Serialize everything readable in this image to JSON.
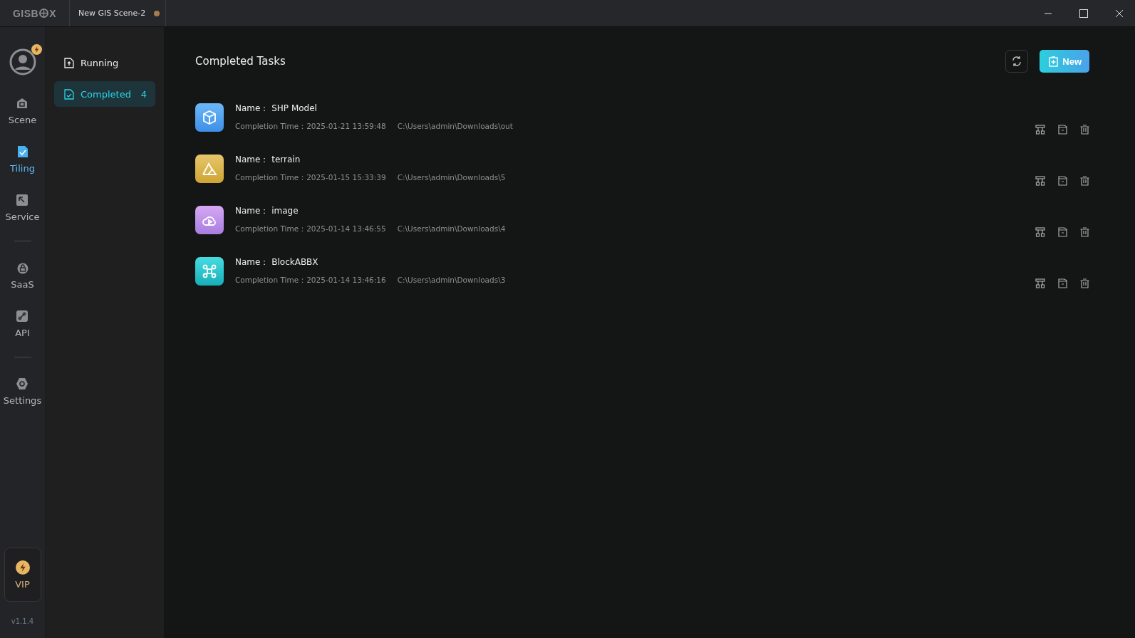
{
  "logo": {
    "before": "GISB",
    "after": "X"
  },
  "tabs": [
    {
      "label": "New GIS Scene-2",
      "selected": true,
      "unsaved": true
    }
  ],
  "rail": [
    {
      "kind": "avatar",
      "badge": true
    },
    {
      "kind": "item",
      "label": "Scene",
      "selected": false
    },
    {
      "kind": "item",
      "label": "Tiling",
      "selected": true
    },
    {
      "kind": "item",
      "label": "Service",
      "selected": false
    },
    {
      "kind": "divider"
    },
    {
      "kind": "item",
      "label": "SaaS",
      "selected": false
    },
    {
      "kind": "item",
      "label": "API",
      "selected": false
    },
    {
      "kind": "divider"
    },
    {
      "kind": "item",
      "label": "Settings",
      "selected": false
    }
  ],
  "vip": {
    "label": "VIP"
  },
  "version": "v1.1.4",
  "subnav": [
    {
      "label": "Running",
      "selected": false
    },
    {
      "label": "Completed",
      "selected": true,
      "count": "4"
    }
  ],
  "page_title": "Completed Tasks",
  "new_button": "New",
  "tasks": [
    {
      "kind": "model",
      "name_label": "Name：",
      "name": "SHP Model",
      "time_label": "Completion Time：",
      "time": "2025-01-21 13:59:48",
      "path": "C:\\Users\\admin\\Downloads\\out"
    },
    {
      "kind": "terrain",
      "name_label": "Name：",
      "name": "terrain",
      "time_label": "Completion Time：",
      "time": "2025-01-15 15:33:39",
      "path": "C:\\Users\\admin\\Downloads\\5"
    },
    {
      "kind": "image",
      "name_label": "Name：",
      "name": "image",
      "time_label": "Completion Time：",
      "time": "2025-01-14 13:46:55",
      "path": "C:\\Users\\admin\\Downloads\\4"
    },
    {
      "kind": "block",
      "name_label": "Name：",
      "name": "BlockABBX",
      "time_label": "Completion Time：",
      "time": "2025-01-14 13:46:16",
      "path": "C:\\Users\\admin\\Downloads\\3"
    }
  ]
}
